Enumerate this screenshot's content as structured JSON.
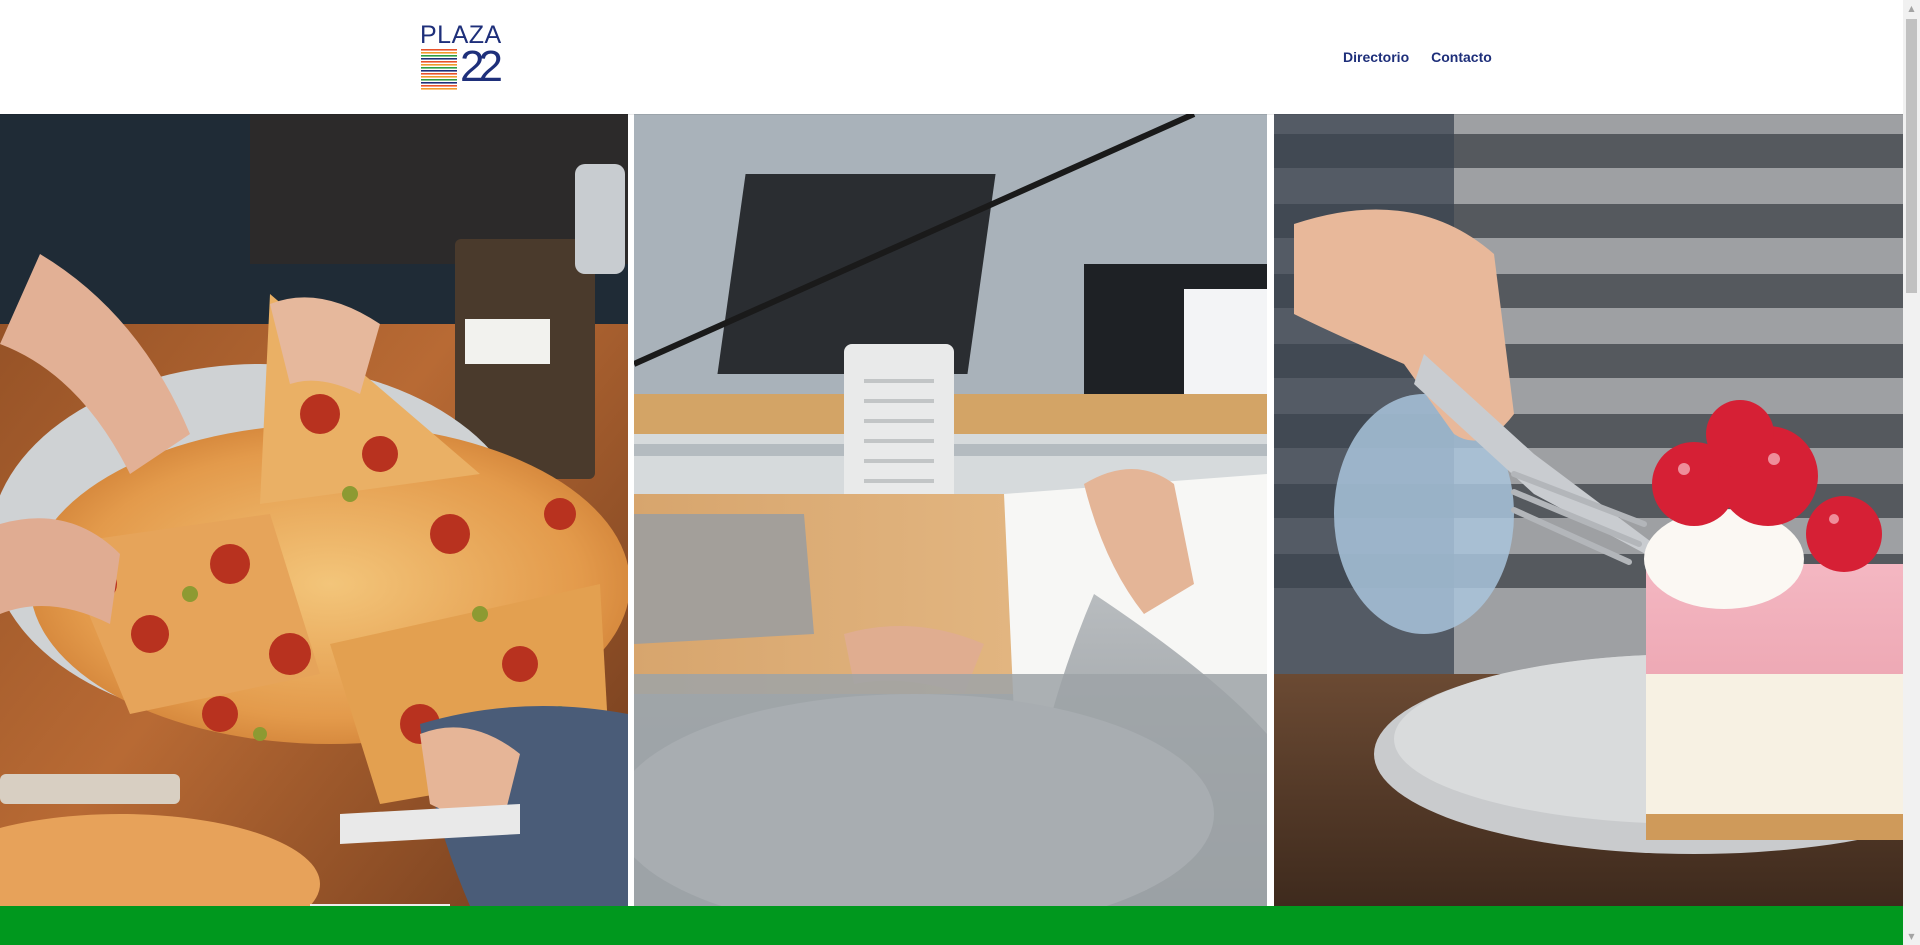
{
  "brand": {
    "logo_word": "PLAZA",
    "logo_number": "22",
    "primary_color": "#1e2f7a",
    "stripe_colors": [
      "#e8532a",
      "#f39a2b",
      "#2f9e44",
      "#1e2f7a"
    ]
  },
  "nav": {
    "items": [
      {
        "label": "Directorio"
      },
      {
        "label": "Contacto"
      }
    ]
  },
  "hero": {
    "panels": [
      {
        "subject": "people sharing pizza at a wooden table"
      },
      {
        "subject": "hand signing a document at a service counter"
      },
      {
        "subject": "fork and strawberry cheesecake on a plate"
      }
    ]
  },
  "footer": {
    "bar_color": "#00981e"
  },
  "scrollbar": {
    "up_icon": "triangle-up",
    "down_icon": "triangle-down"
  }
}
